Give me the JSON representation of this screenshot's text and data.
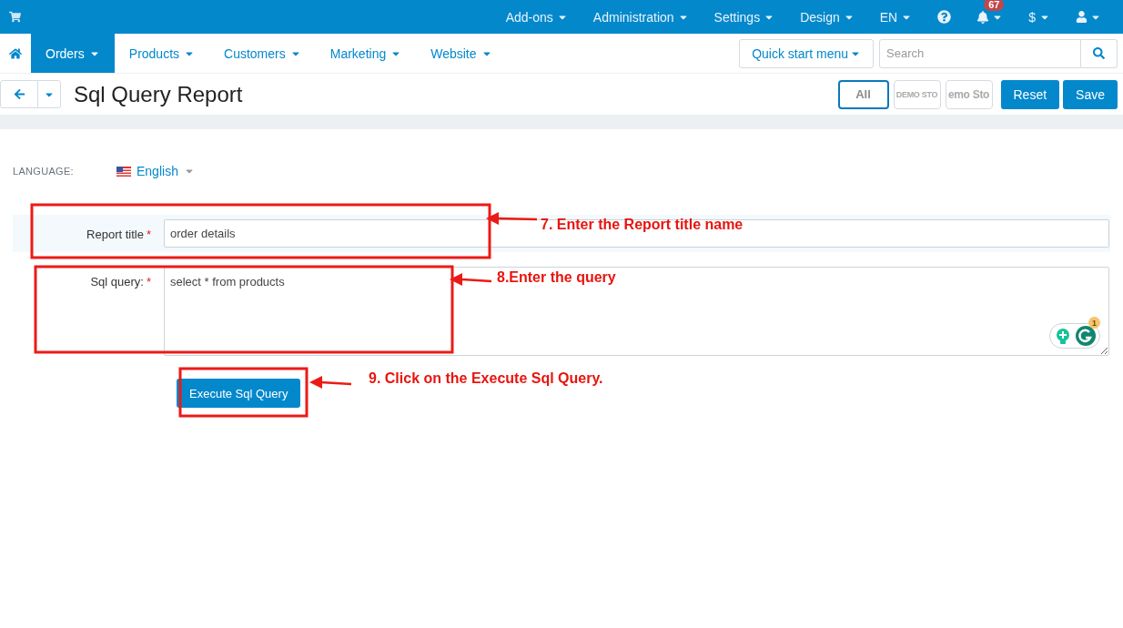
{
  "top_menu": [
    {
      "label": "Add-ons"
    },
    {
      "label": "Administration"
    },
    {
      "label": "Settings"
    },
    {
      "label": "Design"
    },
    {
      "label": "EN"
    }
  ],
  "notifications": {
    "count": "67"
  },
  "currency": {
    "label": "$"
  },
  "nav": [
    {
      "label": "Orders",
      "selected": true
    },
    {
      "label": "Products",
      "selected": false
    },
    {
      "label": "Customers",
      "selected": false
    },
    {
      "label": "Marketing",
      "selected": false
    },
    {
      "label": "Website",
      "selected": false
    }
  ],
  "quick_start": {
    "label": "Quick start menu"
  },
  "search": {
    "placeholder": "Search"
  },
  "page_title": "Sql Query Report",
  "storefronts": [
    {
      "label": "All",
      "selected": true
    },
    {
      "label": "DEMO STO",
      "selected": false
    },
    {
      "label": "emo Sto",
      "selected": false
    }
  ],
  "actions": [
    {
      "label": "Reset"
    },
    {
      "label": "Save"
    }
  ],
  "language": {
    "label": "LANGUAGE:",
    "value": "English"
  },
  "form": [
    {
      "kind": "input",
      "label": "Report title",
      "required_mark": "*",
      "value": "order details",
      "highlighted": true
    },
    {
      "kind": "textarea",
      "label": "Sql query:",
      "required_mark": "*",
      "value": "select * from products",
      "highlighted": false
    }
  ],
  "writing_assistant": {
    "badge": "1"
  },
  "execute_button": "Execute Sql Query",
  "annotations": [
    "7. Enter the Report title name",
    "8.Enter the query",
    "9. Click on the Execute Sql Query."
  ]
}
